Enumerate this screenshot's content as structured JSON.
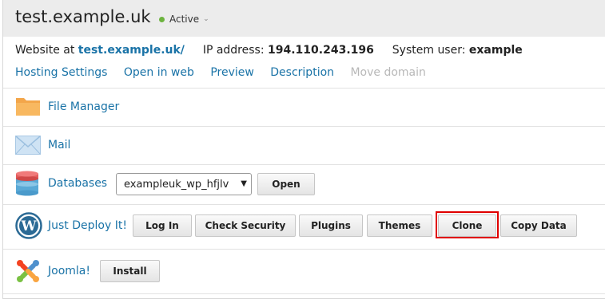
{
  "header": {
    "title": "test.example.uk",
    "status": "Active",
    "status_color": "#6cb33e"
  },
  "info": {
    "website_label": "Website at",
    "website_link": "test.example.uk/",
    "ip_label": "IP address:",
    "ip_value": "194.110.243.196",
    "user_label": "System user:",
    "user_value": "example"
  },
  "actions": [
    {
      "label": "Hosting Settings",
      "enabled": true
    },
    {
      "label": "Open in web",
      "enabled": true
    },
    {
      "label": "Preview",
      "enabled": true
    },
    {
      "label": "Description",
      "enabled": true
    },
    {
      "label": "Move domain",
      "enabled": false
    }
  ],
  "rows": {
    "file_manager": {
      "label": "File Manager",
      "icon": "folder-icon"
    },
    "mail": {
      "label": "Mail",
      "icon": "mail-icon"
    },
    "databases": {
      "label": "Databases",
      "icon": "database-icon",
      "selected": "exampleuk_wp_hfjlv",
      "open_label": "Open"
    },
    "wordpress": {
      "label": "Just Deploy It!",
      "icon": "wordpress-icon",
      "buttons": [
        "Log In",
        "Check Security",
        "Plugins",
        "Themes",
        "Clone",
        "Copy Data"
      ]
    },
    "joomla": {
      "label": "Joomla!",
      "icon": "joomla-icon",
      "install_label": "Install"
    }
  },
  "colors": {
    "link": "#1a73a7",
    "highlight": "#e00000"
  }
}
